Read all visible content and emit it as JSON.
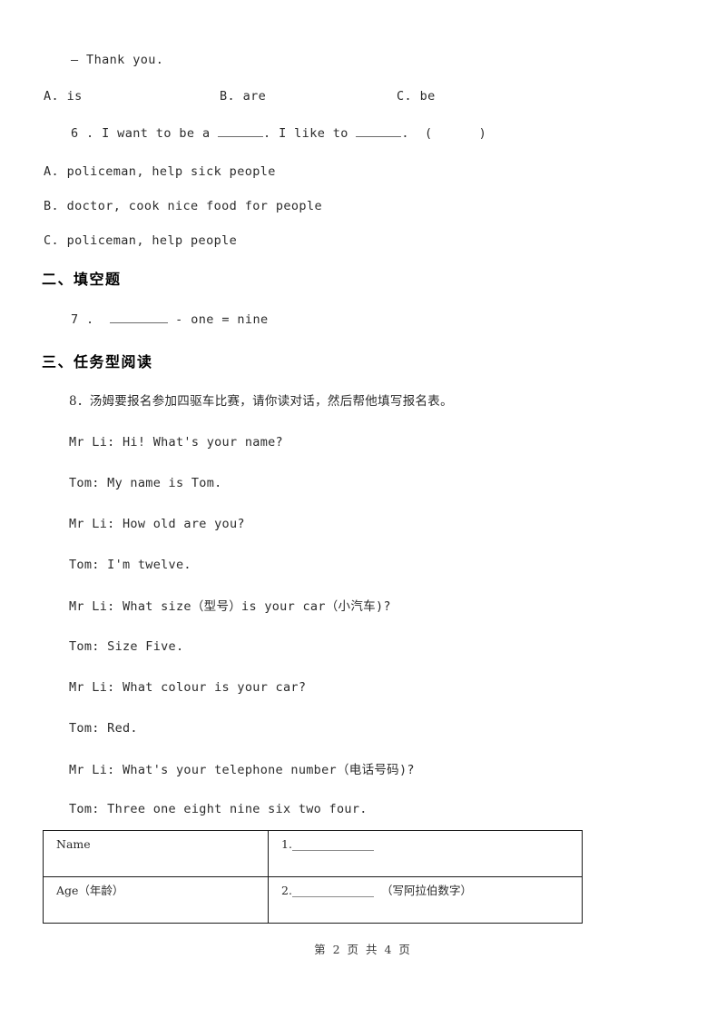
{
  "document": {
    "footer": "第 2 页 共 4 页"
  },
  "carryover": {
    "thank_you_line": "— Thank you.",
    "options": {
      "a": "A. is",
      "b": "B. are",
      "c": "C. be"
    }
  },
  "question6": {
    "stem_prefix": "6 . I want to be a ",
    "stem_mid": ". I like to ",
    "stem_suffix": ".  (      )",
    "options": [
      "A. policeman, help sick people",
      "B. doctor, cook nice food for people",
      "C. policeman, help people"
    ]
  },
  "section2": {
    "heading": "二、填空题",
    "question7_prefix": "7 .  ",
    "question7_suffix": " - one = nine"
  },
  "section3": {
    "heading": "三、任务型阅读",
    "question8_stem": "8．汤姆要报名参加四驱车比赛，请你读对话，然后帮他填写报名表。",
    "dialogue": [
      "Mr Li: Hi! What's your name?",
      "Tom: My name is Tom.",
      "Mr Li: How old are you?",
      "Tom: I'm twelve.",
      "Mr Li: What size（型号）is your car（小汽车)?",
      "Tom: Size Five.",
      "Mr Li: What colour is your car?",
      "Tom: Red.",
      "Mr Li: What's your telephone number（电话号码)?",
      "Tom: Three one eight nine six two four."
    ],
    "table": {
      "rows": [
        {
          "label": "Name",
          "value_number": "1.",
          "value_note": ""
        },
        {
          "label": "Age（年龄）",
          "value_number": "2.",
          "value_note": "（写阿拉伯数字）"
        }
      ]
    }
  }
}
